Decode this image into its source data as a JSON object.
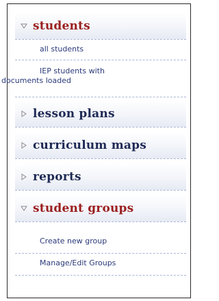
{
  "sections": [
    {
      "label": "students",
      "state": "expanded",
      "items": [
        {
          "label": "all students"
        },
        {
          "label": "IEP students with",
          "label2": "documents loaded"
        }
      ]
    },
    {
      "label": "lesson plans",
      "state": "collapsed"
    },
    {
      "label": "curriculum maps",
      "state": "collapsed"
    },
    {
      "label": "reports",
      "state": "collapsed"
    },
    {
      "label": "student groups",
      "state": "expanded",
      "items": [
        {
          "label": "Create new group"
        },
        {
          "label": "Manage/Edit Groups"
        }
      ]
    }
  ],
  "colors": {
    "expanded_header_text": "#9a1f1f",
    "collapsed_header_text": "#1f2a55",
    "subitem_text": "#2b3a7a",
    "divider": "#a9b6d6"
  }
}
